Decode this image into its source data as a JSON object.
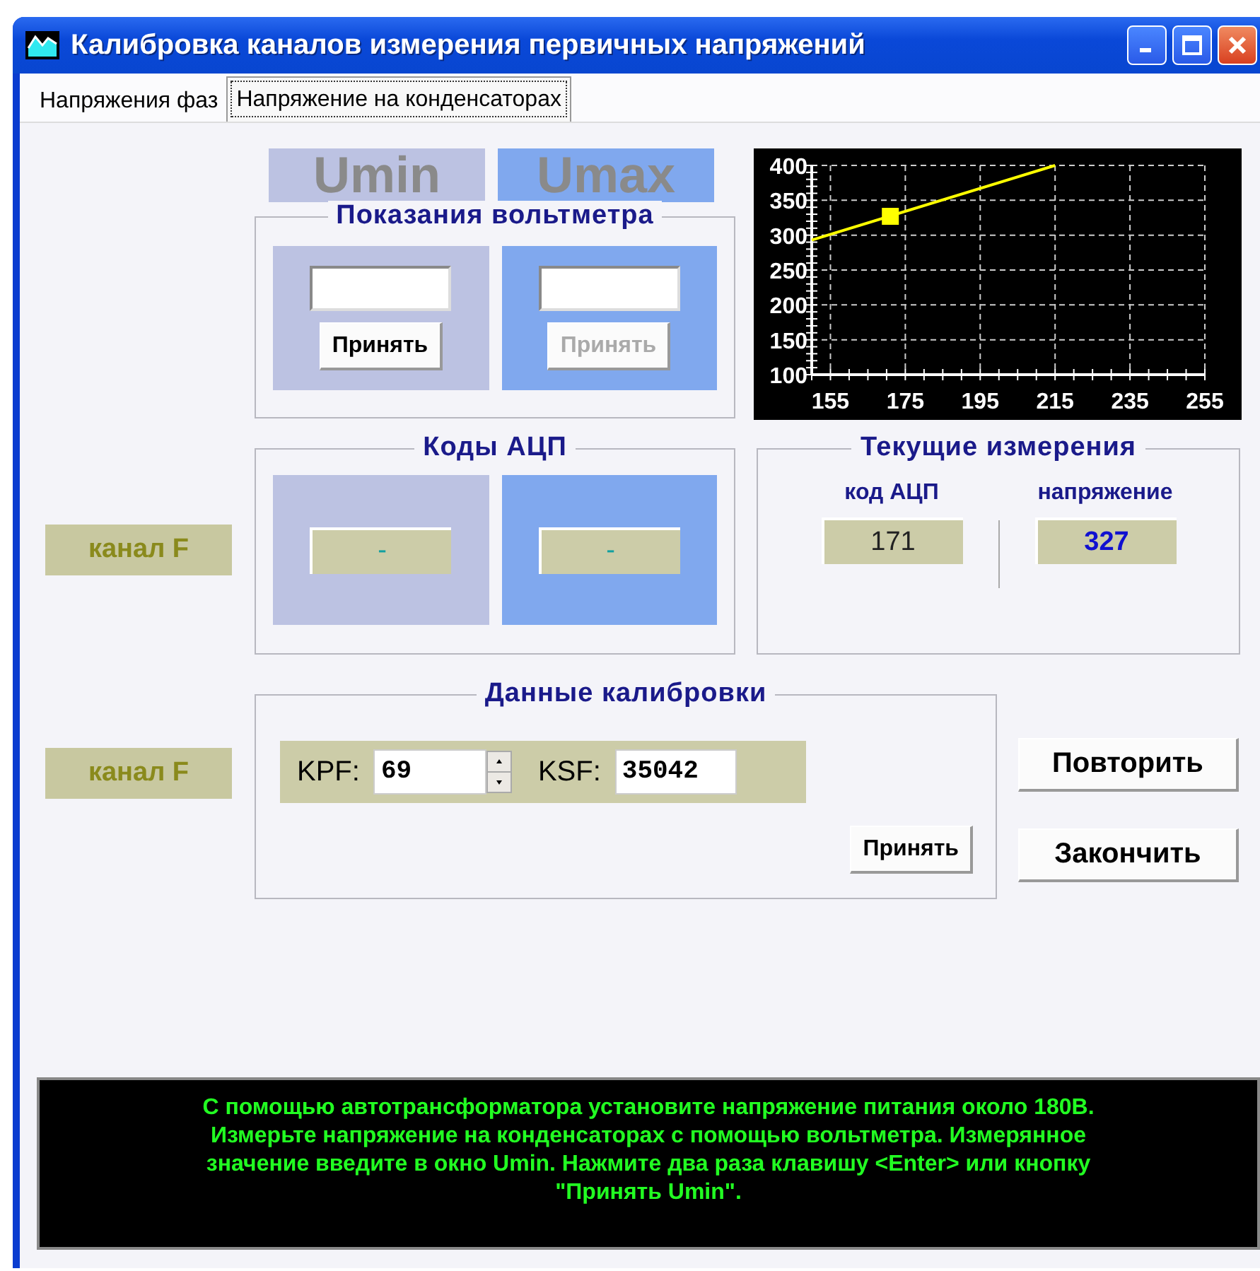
{
  "window": {
    "title": "Калибровка каналов измерения первичных напряжений"
  },
  "tabs": [
    {
      "label": "Напряжения фаз",
      "selected": false
    },
    {
      "label": "Напряжение на конденсаторах",
      "selected": true
    }
  ],
  "voltmeter": {
    "title": "Показания вольтметра",
    "columns": [
      {
        "header": "Umin",
        "button": {
          "label": "Принять",
          "disabled": false
        }
      },
      {
        "header": "Umax",
        "button": {
          "label": "Принять",
          "disabled": true
        }
      }
    ]
  },
  "chart": {
    "chart_data": {
      "type": "line",
      "x": [
        150,
        215
      ],
      "series": [
        {
          "color": "#ffff00",
          "values": [
            293,
            400
          ]
        }
      ],
      "xlim": [
        150,
        255
      ],
      "ylim": [
        100,
        400
      ],
      "xticks": [
        155,
        175,
        195,
        215,
        235,
        255
      ],
      "yticks": [
        100,
        150,
        200,
        250,
        300,
        350,
        400
      ],
      "grid": true
    }
  },
  "adc_codes": {
    "title": "Коды АЦП",
    "channel": "канал F",
    "values": [
      "-",
      "-"
    ]
  },
  "current": {
    "title": "Текущие измерения",
    "items": [
      {
        "label": "код АЦП",
        "value": "171",
        "kind": "code"
      },
      {
        "label": "напряжение",
        "value": "327",
        "kind": "voltage"
      }
    ]
  },
  "calibration": {
    "title": "Данные калибровки",
    "channel": "канал F",
    "fields": [
      {
        "label": "KPF:",
        "value": "69",
        "kind": "spinner"
      },
      {
        "label": "KSF:",
        "value": "35042",
        "kind": "text"
      }
    ],
    "button": "Принять"
  },
  "buttons": [
    "Повторить",
    "Закончить"
  ],
  "message": "С помощью автотрансформатора установите напряжение питания около 180В.\nИзмерьте напряжение на конденсаторах с помощью вольтметра. Измерянное\nзначение введите в окно Umin. Нажмите два раза клавишу <Enter> или кнопку\n\"Принять Umin\"."
}
